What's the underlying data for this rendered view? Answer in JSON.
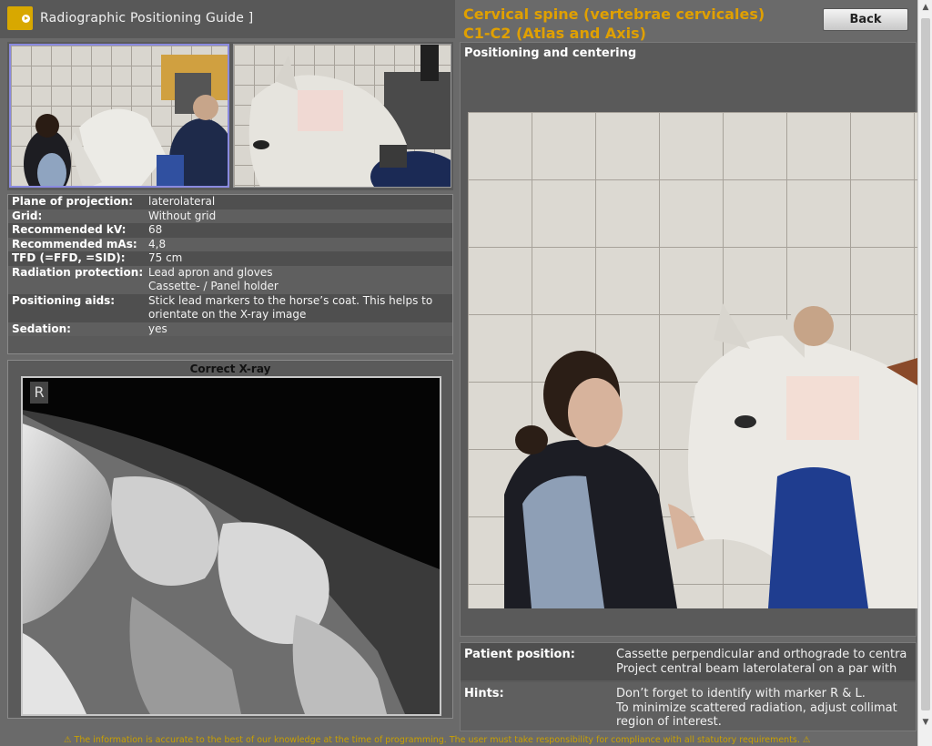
{
  "app": {
    "title": "Radiographic Positioning Guide ]",
    "back_label": "Back"
  },
  "view": {
    "title_line1": "Cervical spine (vertebrae cervicales)",
    "title_line2": "C1-C2 (Atlas and Axis)",
    "section_heading": "Positioning and centering"
  },
  "parameters": [
    {
      "label": "Plane of projection:",
      "value": "laterolateral"
    },
    {
      "label": "Grid:",
      "value": "Without grid"
    },
    {
      "label": "Recommended kV:",
      "value": "68"
    },
    {
      "label": "Recommended mAs:",
      "value": "4,8"
    },
    {
      "label": "TFD (=FFD, =SID):",
      "value": "75 cm"
    },
    {
      "label": "Radiation protection:",
      "value": "Lead apron and gloves",
      "value2": "Cassette- / Panel holder"
    },
    {
      "label": "Positioning aids:",
      "value": "Stick lead markers to the horse’s coat. This helps to",
      "value2": "orientate on the X-ray image"
    },
    {
      "label": "Sedation:",
      "value": "yes"
    }
  ],
  "xray": {
    "title": "Correct X-ray",
    "marker": "R"
  },
  "info": {
    "patient_label": "Patient position:",
    "patient_line1": "Cassette perpendicular and orthograde to centra",
    "patient_line2": "Project central beam laterolateral on a par with",
    "hints_label": "Hints:",
    "hints_line1": "Don’t forget to identify with marker R & L.",
    "hints_line2": "To minimize scattered radiation, adjust collimat",
    "hints_line3": "region of interest."
  },
  "footer": {
    "disclaimer": "⚠ The information is accurate to the best of our knowledge at the time of programming. The user must take responsibility for compliance with all statutory requirements. ⚠"
  },
  "colors": {
    "accent": "#e0a000",
    "logo": "#d8a800",
    "panel": "#5a5a5a",
    "background": "#6a6a6a"
  }
}
